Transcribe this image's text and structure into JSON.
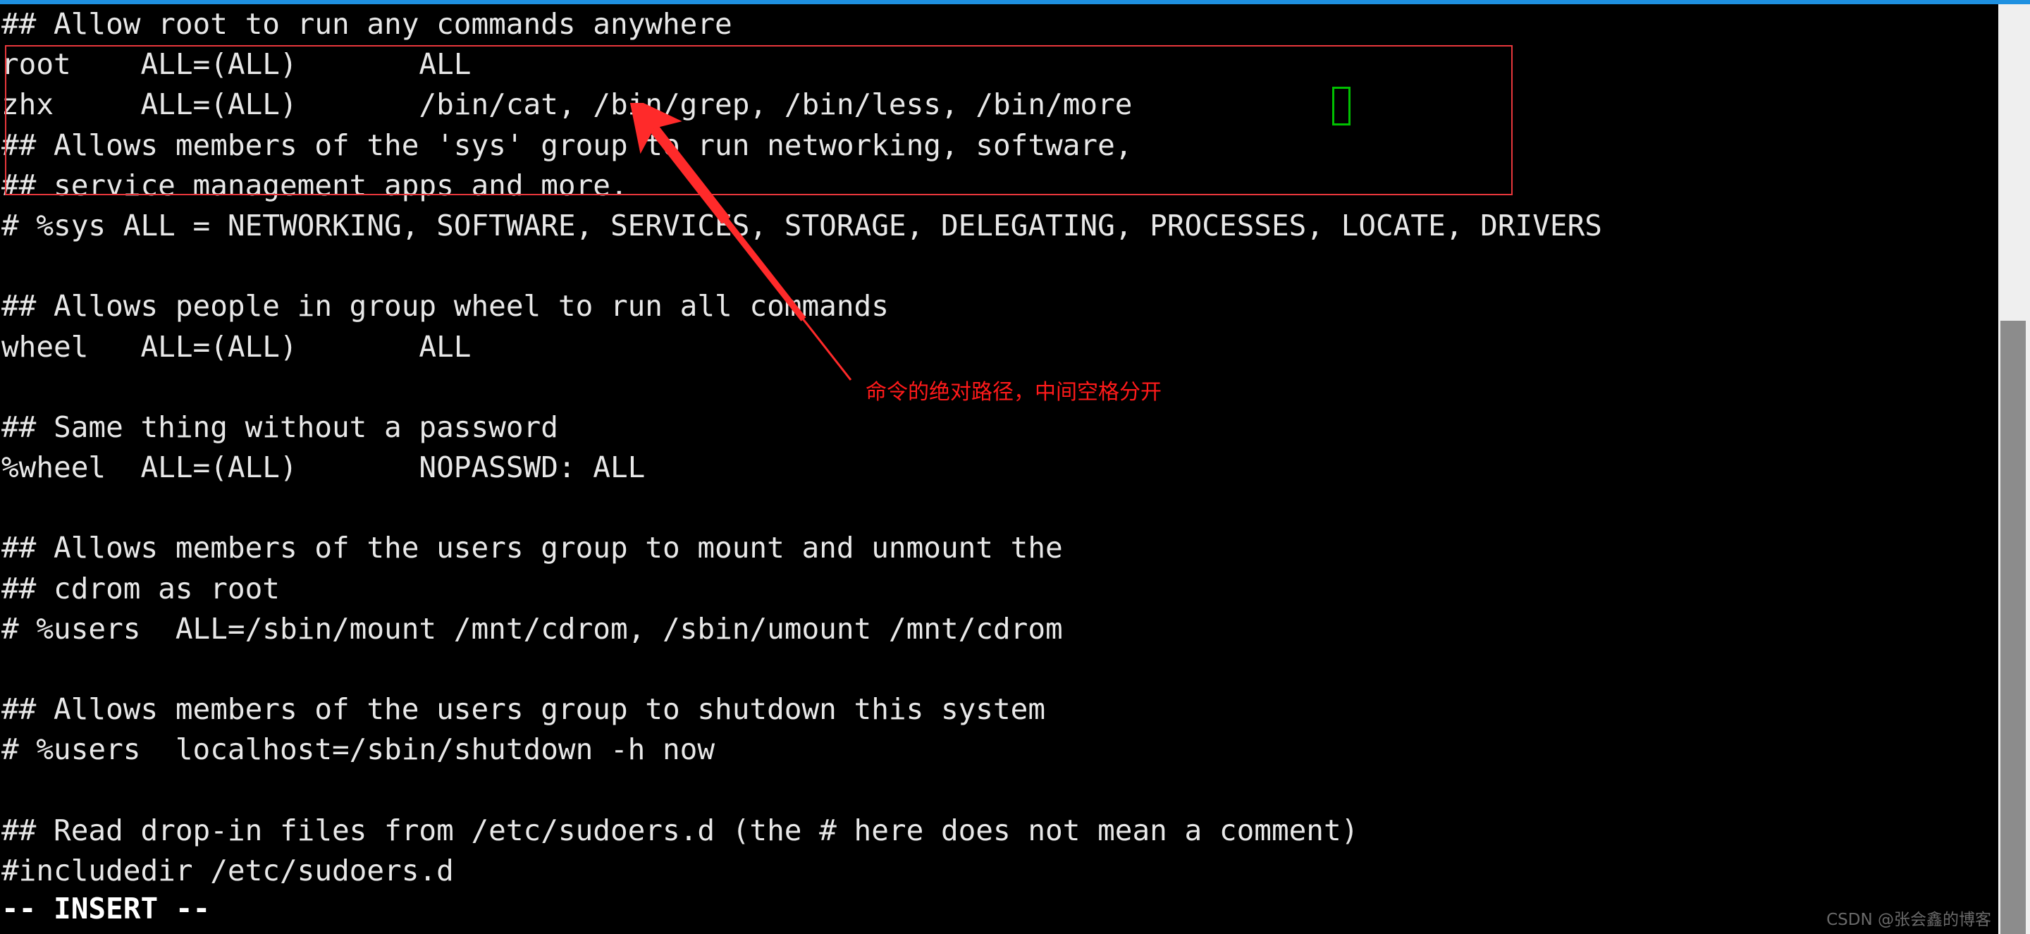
{
  "window": {
    "top_accent_color": "#1e90e0",
    "background_color": "#000000",
    "foreground_color": "#e8e8e8"
  },
  "editor": {
    "app": "vim",
    "file_kind": "sudoers",
    "lines": [
      "## Allow root to run any commands anywhere",
      "root    ALL=(ALL)       ALL",
      "zhx     ALL=(ALL)       /bin/cat, /bin/grep, /bin/less, /bin/more",
      "## Allows members of the 'sys' group to run networking, software,",
      "## service management apps and more.",
      "# %sys ALL = NETWORKING, SOFTWARE, SERVICES, STORAGE, DELEGATING, PROCESSES, LOCATE, DRIVERS",
      "",
      "## Allows people in group wheel to run all commands",
      "wheel   ALL=(ALL)       ALL",
      "",
      "## Same thing without a password",
      "%wheel  ALL=(ALL)       NOPASSWD: ALL",
      "",
      "## Allows members of the users group to mount and unmount the",
      "## cdrom as root",
      "# %users  ALL=/sbin/mount /mnt/cdrom, /sbin/umount /mnt/cdrom",
      "",
      "## Allows members of the users group to shutdown this system",
      "# %users  localhost=/sbin/shutdown -h now",
      "",
      "## Read drop-in files from /etc/sudoers.d (the # here does not mean a comment)",
      "#includedir /etc/sudoers.d"
    ],
    "status_line": "-- INSERT --",
    "cursor": {
      "shape": "block-outline",
      "color": "#00c000",
      "after_text": "/bin/more"
    }
  },
  "annotations": {
    "highlight_box": {
      "color": "#e8373c",
      "encloses_lines": [
        "root    ALL=(ALL)       ALL",
        "zhx     ALL=(ALL)       /bin/cat, /bin/grep, /bin/less, /bin/more",
        "## Allows members of the 'sys' group to run networking, software,",
        "## service management apps and more."
      ]
    },
    "arrow": {
      "color": "#ff2a2a",
      "points_to": "/bin/cat,"
    },
    "caption": {
      "color": "#ff1a1a",
      "text": "命令的绝对路径，中间空格分开"
    }
  },
  "scrollbar": {
    "track_color": "#efefef",
    "thumb_color": "#8c8c8c",
    "orientation": "vertical"
  },
  "watermark": {
    "text": "CSDN @张会鑫的博客"
  }
}
